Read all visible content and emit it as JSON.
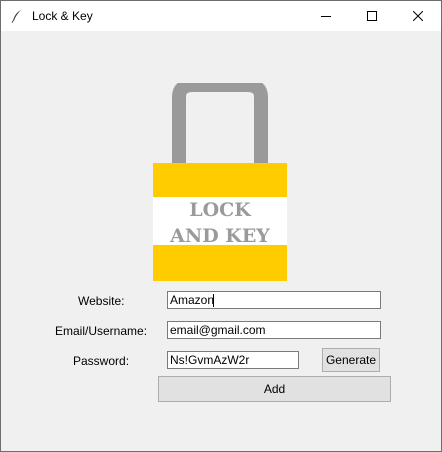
{
  "window": {
    "title": "Lock & Key"
  },
  "logo": {
    "line1": "LOCK",
    "line2": "AND KEY"
  },
  "form": {
    "website_label": "Website:",
    "website_value": "Amazon",
    "email_label": "Email/Username:",
    "email_value": "email@gmail.com",
    "password_label": "Password:",
    "password_value": "Ns!GvmAzW2r",
    "generate_label": "Generate",
    "add_label": "Add"
  },
  "colors": {
    "lock_body": "#ffcc00",
    "shackle": "#9a9a9a",
    "logo_text": "#9a9a9a",
    "window_bg": "#f0f0f0"
  }
}
